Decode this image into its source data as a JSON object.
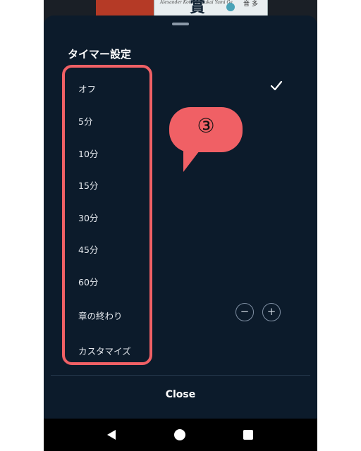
{
  "sheet": {
    "title": "タイマー設定",
    "options": [
      {
        "label": "オフ",
        "selected": true
      },
      {
        "label": "5分",
        "selected": false
      },
      {
        "label": "10分",
        "selected": false
      },
      {
        "label": "15分",
        "selected": false
      },
      {
        "label": "30分",
        "selected": false
      },
      {
        "label": "45分",
        "selected": false
      },
      {
        "label": "60分",
        "selected": false
      },
      {
        "label": "章の終わり",
        "selected": false
      },
      {
        "label": "カスタマイズ",
        "selected": false
      }
    ],
    "minus_label": "−",
    "plus_label": "+",
    "close_label": "Close"
  },
  "background_book": {
    "title_char": "賞",
    "side_chars": "音 多",
    "small_text": "Alexander Kotoba Tsukai Yumi Ga"
  },
  "annotation": {
    "callout_label": "③",
    "color": "#f06065"
  },
  "colors": {
    "sheet_bg": "#0c1b2b",
    "text": "#e6eaef",
    "accent": "#f06065"
  },
  "icons": {
    "check": "check-icon",
    "back": "nav-back-icon",
    "home": "nav-home-icon",
    "recent": "nav-recents-icon"
  }
}
